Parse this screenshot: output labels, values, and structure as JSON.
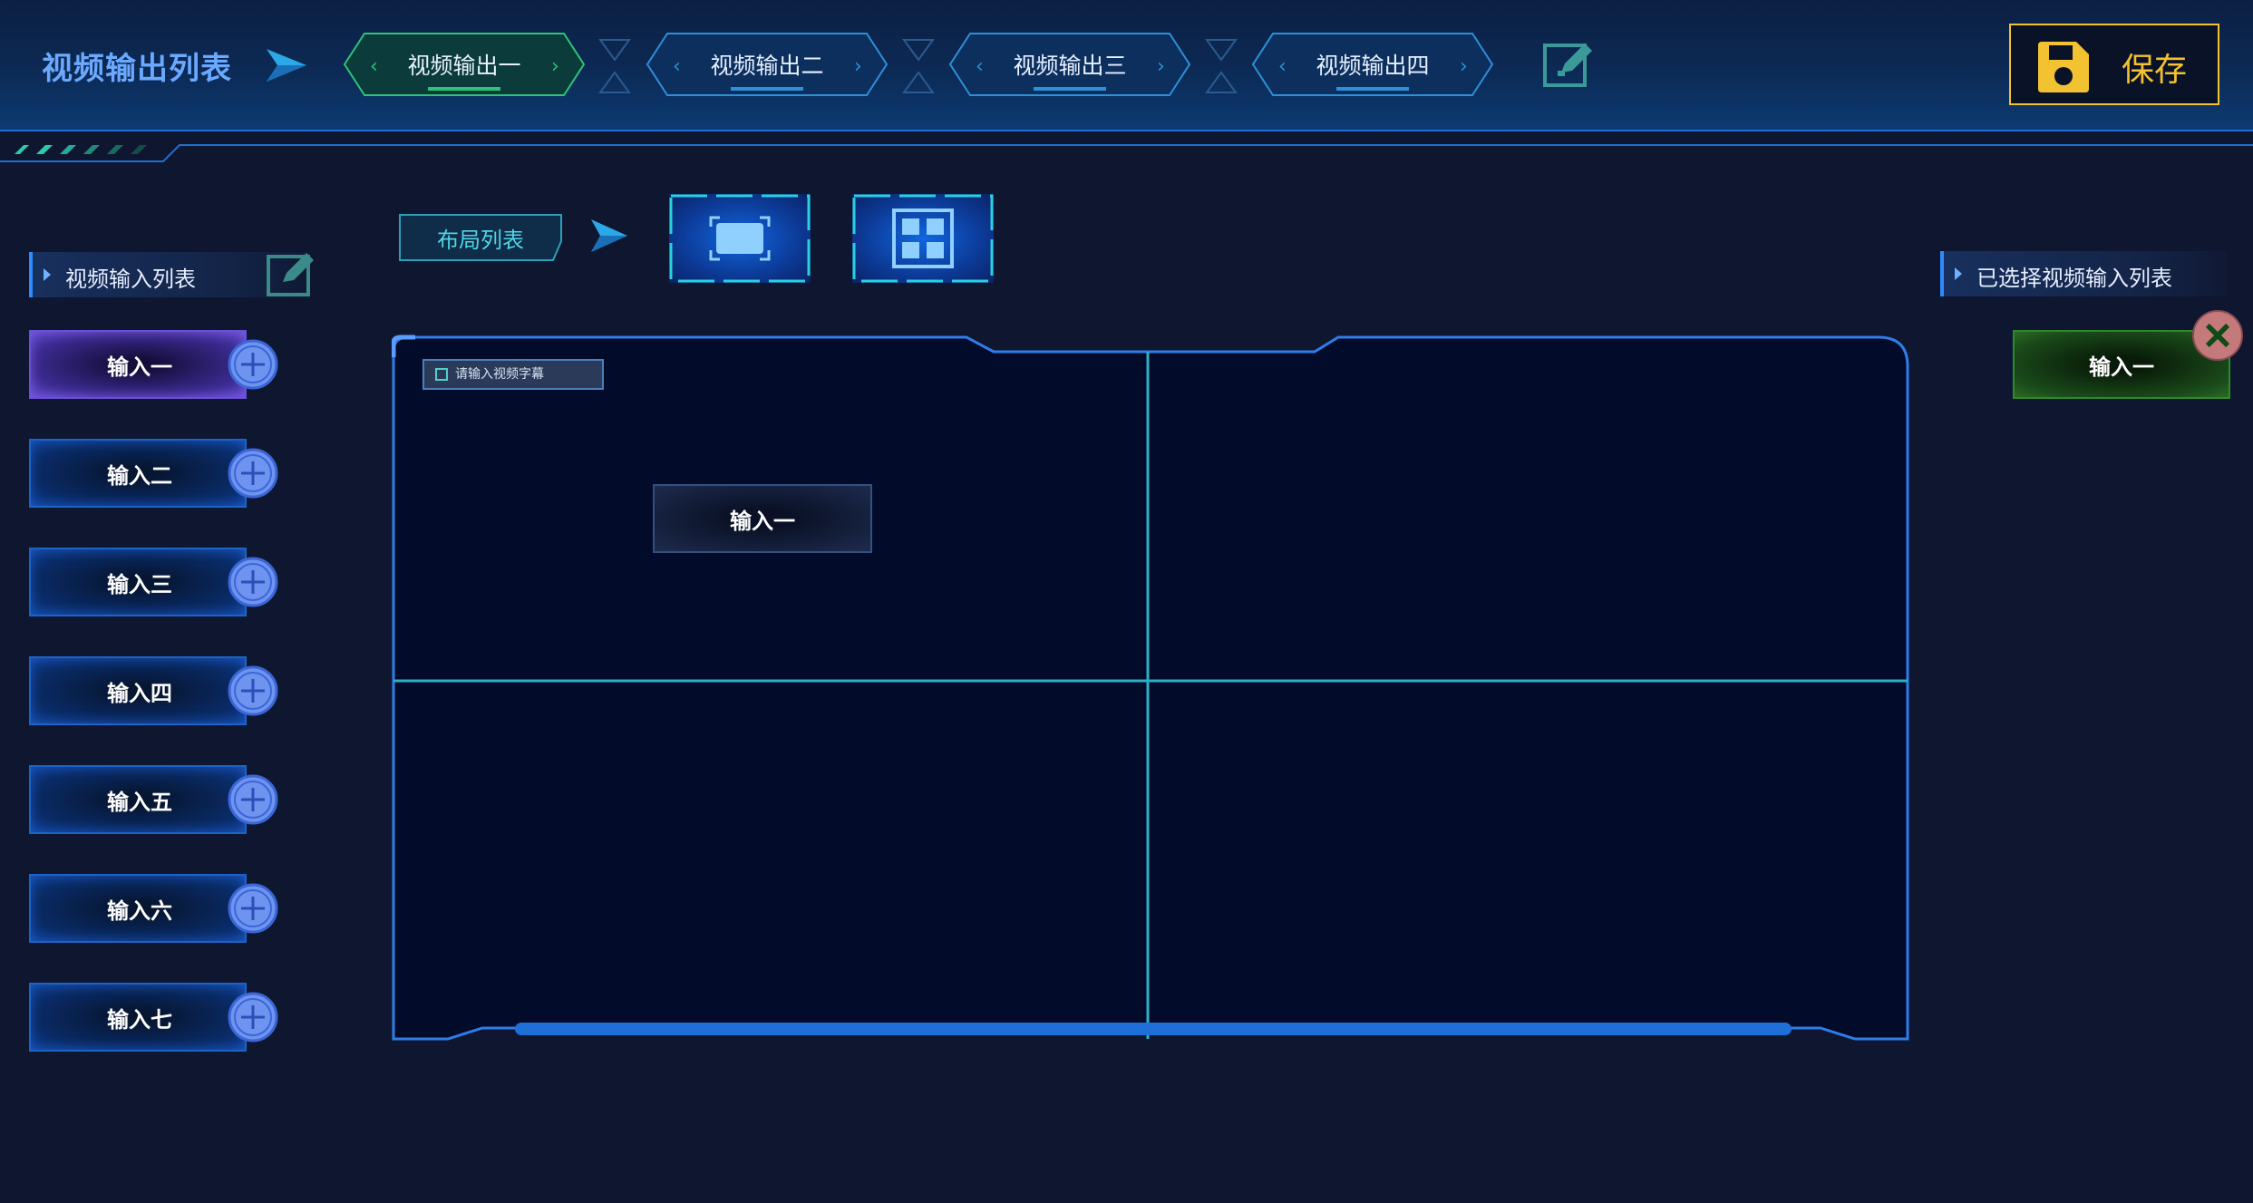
{
  "header": {
    "title": "视频输出列表",
    "tabs": [
      {
        "label": "视频输出一",
        "active": true
      },
      {
        "label": "视频输出二",
        "active": false
      },
      {
        "label": "视频输出三",
        "active": false
      },
      {
        "label": "视频输出四",
        "active": false
      }
    ],
    "save_label": "保存"
  },
  "left_panel": {
    "title": "视频输入列表",
    "inputs": [
      {
        "label": "输入一",
        "active": true
      },
      {
        "label": "输入二",
        "active": false
      },
      {
        "label": "输入三",
        "active": false
      },
      {
        "label": "输入四",
        "active": false
      },
      {
        "label": "输入五",
        "active": false
      },
      {
        "label": "输入六",
        "active": false
      },
      {
        "label": "输入七",
        "active": false
      }
    ]
  },
  "layout": {
    "title": "布局列表",
    "options": [
      {
        "icon": "single-screen-icon",
        "selected": true
      },
      {
        "icon": "quad-screen-icon",
        "selected": false
      }
    ]
  },
  "canvas": {
    "caption_placeholder": "请输入视频字幕",
    "cells": [
      {
        "input": "输入一"
      },
      {
        "input": ""
      },
      {
        "input": ""
      },
      {
        "input": ""
      }
    ]
  },
  "right_panel": {
    "title": "已选择视频输入列表",
    "selected": [
      {
        "label": "输入一"
      }
    ]
  },
  "colors": {
    "accent_blue": "#2f8cff",
    "accent_cyan": "#34c6d8",
    "save_yellow": "#f2c230",
    "active_tab_green": "#29b36a",
    "selected_green": "#2c8a2c",
    "active_input_purple": "#6a4fd8"
  }
}
